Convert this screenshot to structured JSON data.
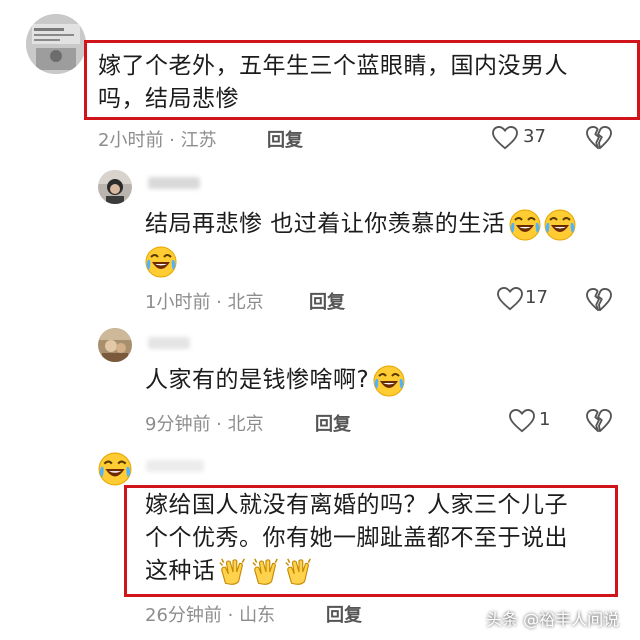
{
  "comments": [
    {
      "text_line1": "嫁了个老外，五年生三个蓝眼睛，国内没男人",
      "text_line2": "吗，结局悲惨",
      "time": "2小时前",
      "location": "江苏",
      "reply": "回复",
      "likes": "37"
    },
    {
      "text_line1": "结局再悲惨  也过着让你羡慕的生活",
      "time": "1小时前",
      "location": "北京",
      "reply": "回复",
      "likes": "17"
    },
    {
      "text_line1": "人家有的是钱惨啥啊?",
      "time": "9分钟前",
      "location": "北京",
      "reply": "回复",
      "likes": "1"
    },
    {
      "text_line1": "嫁给国人就没有离婚的吗？人家三个儿子",
      "text_line2": "个个优秀。你有她一脚趾盖都不至于说出",
      "text_line3": "这种话",
      "time": "26分钟前",
      "location": "山东",
      "reply": "回复"
    }
  ],
  "separator": " · ",
  "watermark": "头条 @裕丰人间说",
  "colors": {
    "highlight": "#d0141a",
    "meta": "#8d8d8d"
  },
  "icons": [
    "heart-icon",
    "broken-heart-icon",
    "laughing-crying-emoji",
    "clapping-emoji"
  ]
}
